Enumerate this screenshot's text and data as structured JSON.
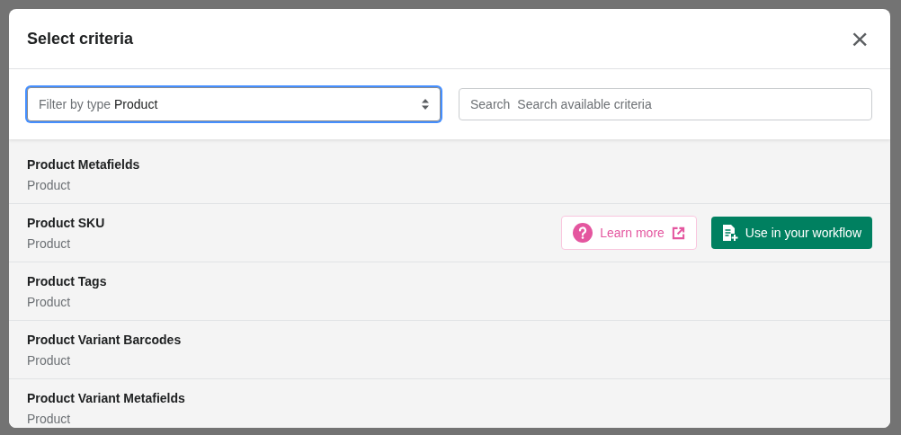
{
  "dialog": {
    "title": "Select criteria",
    "close": "×"
  },
  "filter": {
    "label": "Filter by type",
    "value": "Product",
    "focused": true
  },
  "search": {
    "label": "Search",
    "placeholder": "Search available criteria"
  },
  "criteria": [
    {
      "name": "Product Metafields",
      "type": "Product"
    },
    {
      "name": "Product SKU",
      "type": "Product",
      "actions": [
        {
          "kind": "help",
          "label": "Learn more"
        },
        {
          "kind": "use",
          "label": "Use in your workflow"
        }
      ]
    },
    {
      "name": "Product Tags",
      "type": "Product"
    },
    {
      "name": "Product Variant Barcodes",
      "type": "Product"
    },
    {
      "name": "Product Variant Metafields",
      "type": "Product"
    }
  ]
}
